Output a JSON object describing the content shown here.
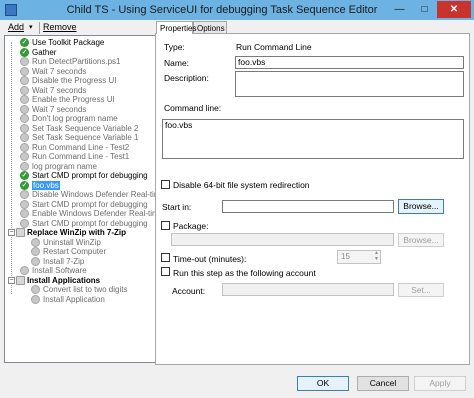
{
  "window": {
    "title": "Child TS - Using ServiceUI for debugging Task Sequence Editor",
    "minimize_glyph": "—",
    "maximize_glyph": "□",
    "close_glyph": "✕"
  },
  "toolbar": {
    "add_label": "Add",
    "add_caret": "▾",
    "remove_label": "Remove"
  },
  "tree": {
    "items": [
      {
        "label": "Use Toolkit Package",
        "state": "success",
        "level": 1
      },
      {
        "label": "Gather",
        "state": "success",
        "level": 1
      },
      {
        "label": "Run DetectPartitions.ps1",
        "state": "disabled",
        "level": 1
      },
      {
        "label": "Wait 7 seconds",
        "state": "disabled",
        "level": 1
      },
      {
        "label": "Disable the Progress UI",
        "state": "disabled",
        "level": 1
      },
      {
        "label": "Wait 7 seconds",
        "state": "disabled",
        "level": 1
      },
      {
        "label": "Enable the Progress UI",
        "state": "disabled",
        "level": 1
      },
      {
        "label": "Wait 7 seconds",
        "state": "disabled",
        "level": 1
      },
      {
        "label": "Don't log program name",
        "state": "disabled",
        "level": 1
      },
      {
        "label": "Set Task Sequence Variable 2",
        "state": "disabled",
        "level": 1
      },
      {
        "label": "Set Task Sequence Variable 1",
        "state": "disabled",
        "level": 1
      },
      {
        "label": "Run Command Line - Test2",
        "state": "disabled",
        "level": 1
      },
      {
        "label": "Run Command Line - Test1",
        "state": "disabled",
        "level": 1
      },
      {
        "label": "log program name",
        "state": "disabled",
        "level": 1
      },
      {
        "label": "Start CMD prompt for debugging",
        "state": "success",
        "level": 1
      },
      {
        "label": "foo.vbs",
        "state": "selected",
        "level": 1
      },
      {
        "label": "Disable Windows Defender Real-time",
        "state": "disabled",
        "level": 1
      },
      {
        "label": "Start CMD prompt for debugging",
        "state": "disabled",
        "level": 1
      },
      {
        "label": "Enable Windows Defender Real-time",
        "state": "disabled",
        "level": 1
      },
      {
        "label": "Start CMD prompt for debugging",
        "state": "disabled",
        "level": 1
      },
      {
        "label": "Replace WinZip with 7-Zip",
        "state": "group",
        "level": 0
      },
      {
        "label": "Uninstall WinZip",
        "state": "disabled",
        "level": 2
      },
      {
        "label": "Restart Computer",
        "state": "disabled",
        "level": 2
      },
      {
        "label": "Install 7-Zip",
        "state": "disabled",
        "level": 2
      },
      {
        "label": "Install Software",
        "state": "disabled",
        "level": 1
      },
      {
        "label": "Install Applications",
        "state": "group",
        "level": 0
      },
      {
        "label": "Convert list to two digits",
        "state": "disabled",
        "level": 2
      },
      {
        "label": "Install Application",
        "state": "disabled",
        "level": 2
      }
    ],
    "expander_glyph": "−",
    "check_glyph": "✓"
  },
  "tabs": [
    {
      "label": "Properties",
      "active": true
    },
    {
      "label": "Options",
      "active": false
    }
  ],
  "properties": {
    "type_label": "Type:",
    "type_value": "Run Command Line",
    "name_label": "Name:",
    "name_value": "foo.vbs",
    "description_label": "Description:",
    "description_value": "",
    "command_line_label": "Command line:",
    "command_line_value": "foo.vbs",
    "disable_64bit_label": "Disable 64-bit file system redirection",
    "start_in_label": "Start in:",
    "start_in_value": "",
    "browse_label": "Browse...",
    "package_label": "Package:",
    "package_value": "",
    "timeout_label": "Time-out (minutes):",
    "timeout_value": "15",
    "run_as_label": "Run this step as the following account",
    "account_label": "Account:",
    "account_value": "",
    "set_label": "Set...",
    "spin_up": "▲",
    "spin_down": "▼"
  },
  "footer": {
    "ok_label": "OK",
    "cancel_label": "Cancel",
    "apply_label": "Apply"
  }
}
